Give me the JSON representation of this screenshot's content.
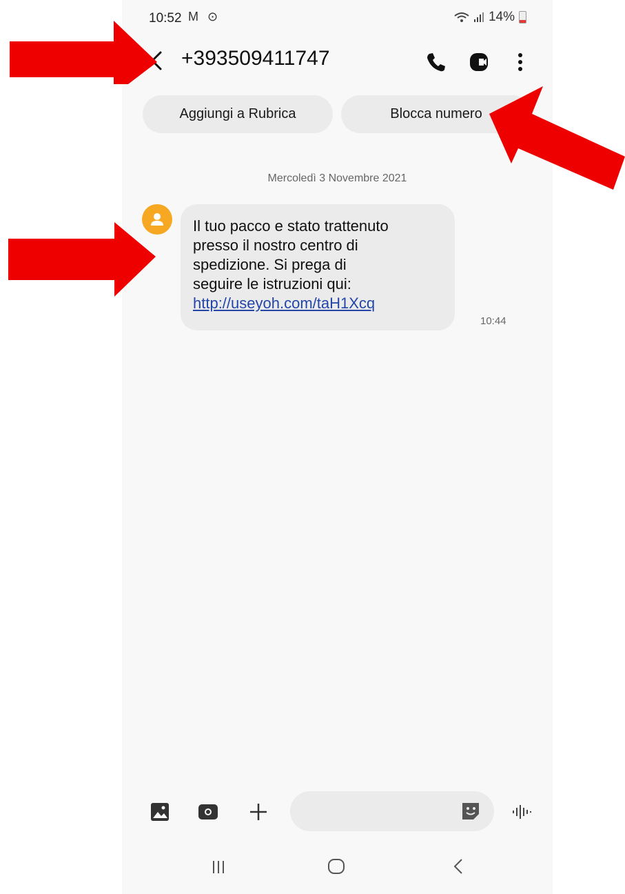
{
  "status_bar": {
    "time": "10:52",
    "left_icons": "M ⊙",
    "battery": "14%"
  },
  "header": {
    "title": "+393509411747"
  },
  "chips": {
    "add_contact": "Aggiungi a Rubrica",
    "block_number": "Blocca numero"
  },
  "conversation": {
    "date": "Mercoledì 3 Novembre 2021",
    "message": {
      "lines": [
        "Il tuo pacco e stato trattenuto",
        "presso il nostro centro di",
        "spedizione. Si prega di",
        "seguire le istruzioni qui:"
      ],
      "link": "http://useyoh.com/taH1Xcq",
      "time": "10:44"
    }
  },
  "composer": {
    "placeholder": ""
  },
  "icons": [
    "back-icon",
    "phone-icon",
    "video-call-icon",
    "more-icon",
    "gallery-icon",
    "camera-icon",
    "plus-icon",
    "sticker-icon",
    "voice-icon",
    "recents-icon",
    "home-icon",
    "nav-back-icon"
  ],
  "colors": {
    "avatar": "#f7a823",
    "link": "#2346a8",
    "annotation_arrow": "#ee0000",
    "background": "#f8f8f8",
    "chip": "#ebebeb"
  }
}
